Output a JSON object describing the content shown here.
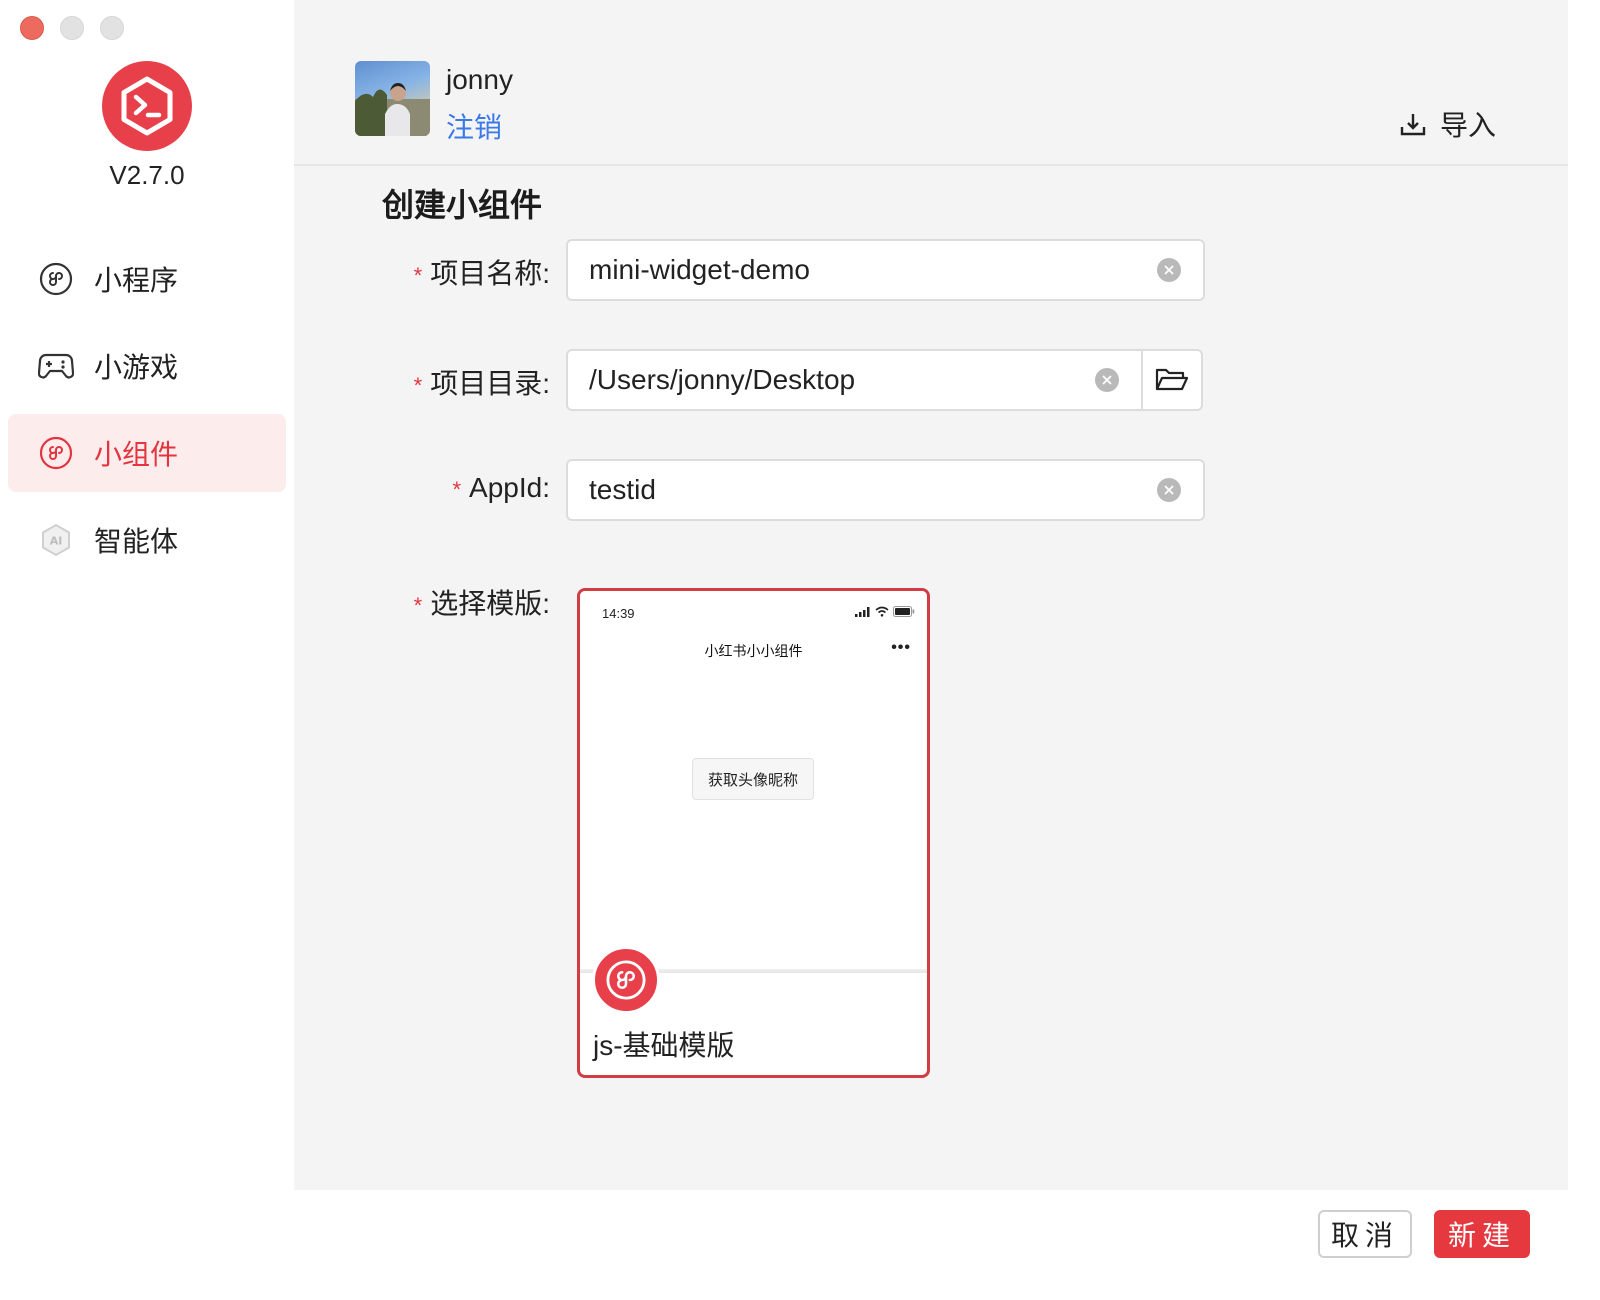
{
  "app": {
    "version": "V2.7.0",
    "brand_color": "#e8404b"
  },
  "sidebar": {
    "items": [
      {
        "label": "小程序",
        "icon": "mini-program-icon",
        "active": false
      },
      {
        "label": "小游戏",
        "icon": "gamepad-icon",
        "active": false
      },
      {
        "label": "小组件",
        "icon": "mini-program-icon",
        "active": true
      },
      {
        "label": "智能体",
        "icon": "ai-hexagon-icon",
        "active": false
      }
    ]
  },
  "header": {
    "username": "jonny",
    "logout_label": "注销",
    "import_label": "导入"
  },
  "form": {
    "title": "创建小组件",
    "project_name": {
      "label": "项目名称",
      "value": "mini-widget-demo"
    },
    "project_dir": {
      "label": "项目目录",
      "value": "/Users/jonny/Desktop"
    },
    "appid": {
      "label": "AppId",
      "value": "testid"
    },
    "template": {
      "label": "选择模版"
    },
    "colon": ":",
    "required_mark": "*"
  },
  "template_card": {
    "name": "js-基础模版",
    "preview": {
      "time": "14:39",
      "title": "小红书小小组件",
      "more": "•••",
      "button_label": "获取头像昵称"
    }
  },
  "footer": {
    "cancel_label": "取消",
    "create_label": "新建"
  }
}
